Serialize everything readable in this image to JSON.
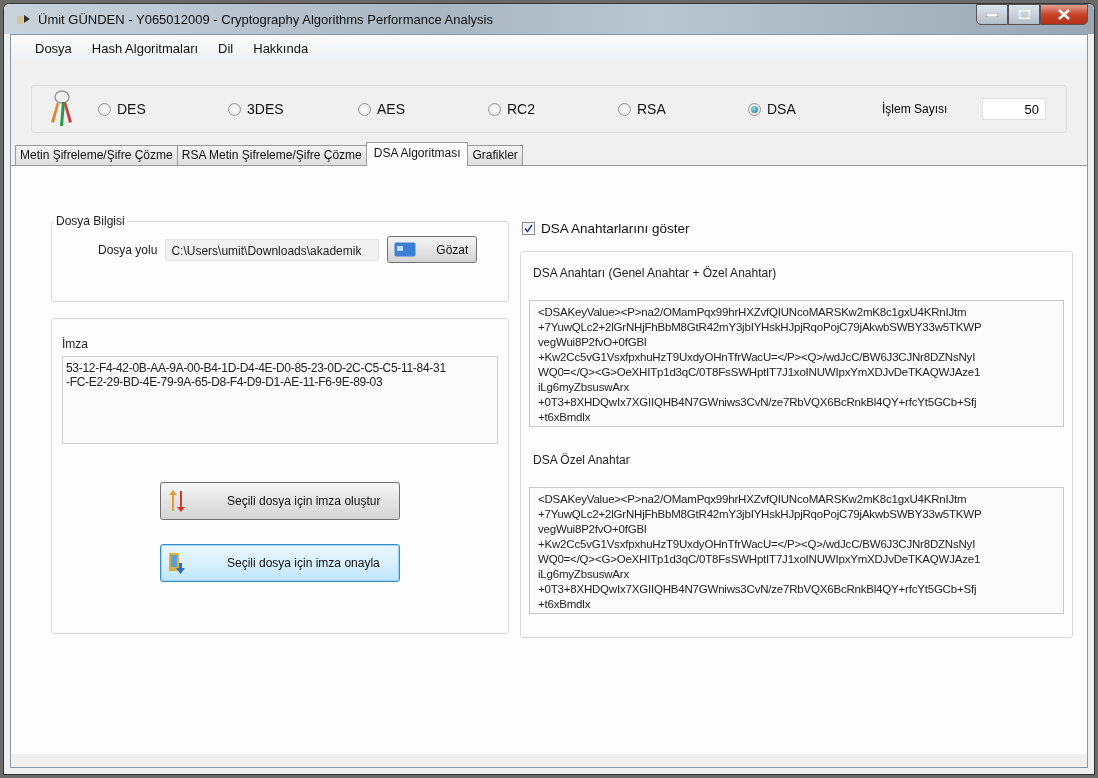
{
  "window": {
    "title": "Ümit GÜNDEN - Y065012009 - Cryptography Algorithms Performance Analysis"
  },
  "menu": [
    "Dosya",
    "Hash Algoritmaları",
    "Dil",
    "Hakkında"
  ],
  "algorithms": [
    {
      "label": "DES",
      "selected": false
    },
    {
      "label": "3DES",
      "selected": false
    },
    {
      "label": "AES",
      "selected": false
    },
    {
      "label": "RC2",
      "selected": false
    },
    {
      "label": "RSA",
      "selected": false
    },
    {
      "label": "DSA",
      "selected": true
    }
  ],
  "operation_count": {
    "label": "İşlem Sayısı",
    "value": "50"
  },
  "tabs": [
    {
      "label": "Metin Şifreleme/Şifre Çözme",
      "selected": false
    },
    {
      "label": "RSA Metin Şifreleme/Şifre Çözme",
      "selected": false
    },
    {
      "label": "DSA Algoritması",
      "selected": true
    },
    {
      "label": "Grafikler",
      "selected": false
    }
  ],
  "file_info": {
    "title": "Dosya Bilgisi",
    "path_label": "Dosya yolu",
    "path_value": "C:\\Users\\umit\\Downloads\\akademik ",
    "browse_button": "Gözat"
  },
  "signature": {
    "label": "İmza",
    "value": [
      "53-12-F4-42-0B-AA-9A-00-B4-1D-D4-4E-D0-85-23-0D-2C-C5-C5-11-84-31",
      "-FC-E2-29-BD-4E-79-9A-65-D8-F4-D9-D1-AE-11-F6-9E-89-03"
    ]
  },
  "buttons": [
    {
      "label": "Seçili dosya için imza oluştur",
      "kind": "create",
      "focused": false
    },
    {
      "label": "Seçili dosya için imza onayla",
      "kind": "verify",
      "focused": true
    }
  ],
  "show_keys": {
    "label": "DSA Anahtarlarını göster",
    "checked": true
  },
  "keys": [
    {
      "label": "DSA Anahtarı (Genel Anahtar + Özel Anahtar)",
      "value": [
        "<DSAKeyValue><P>na2/OMamPqx99hrHXZvfQIUNcoMARSKw2mK8c1gxU4KRnIJtm",
        "+7YuwQLc2+2lGrNHjFhBbM8GtR42mY3jbIYHskHJpjRqoPojC79jAkwbSWBY33w5TKWP",
        "vegWui8P2fvO+0fGBl",
        "+Kw2Cc5vG1VsxfpxhuHzT9UxdyOHnTfrWacU=</P><Q>/wdJcC/BW6J3CJNr8DZNsNyI",
        "WQ0=</Q><G>OeXHITp1d3qC/0T8FsSWHptIT7J1xoINUWIpxYmXDJvDeTKAQWJAze1",
        "iLg6myZbsuswArx",
        "+0T3+8XHDQwIx7XGIIQHB4N7GWniws3CvN/ze7RbVQX6BcRnkBl4QY+rfcYt5GCb+Sfj",
        "+t6xBmdlx"
      ]
    },
    {
      "label": "DSA Özel Anahtar",
      "value": [
        "<DSAKeyValue><P>na2/OMamPqx99hrHXZvfQIUNcoMARSKw2mK8c1gxU4KRnIJtm",
        "+7YuwQLc2+2lGrNHjFhBbM8GtR42mY3jbIYHskHJpjRqoPojC79jAkwbSWBY33w5TKWP",
        "vegWui8P2fvO+0fGBl",
        "+Kw2Cc5vG1VsxfpxhuHzT9UxdyOHnTfrWacU=</P><Q>/wdJcC/BW6J3CJNr8DZNsNyI",
        "WQ0=</Q><G>OeXHITp1d3qC/0T8FsSWHptIT7J1xoINUWIpxYmXDJvDeTKAQWJAze1",
        "iLg6myZbsuswArx",
        "+0T3+8XHDQwIx7XGIIQHB4N7GWniws3CvN/ze7RbVQX6BcRnkBl4QY+rfcYt5GCb+Sfj",
        "+t6xBmdlx"
      ]
    }
  ]
}
